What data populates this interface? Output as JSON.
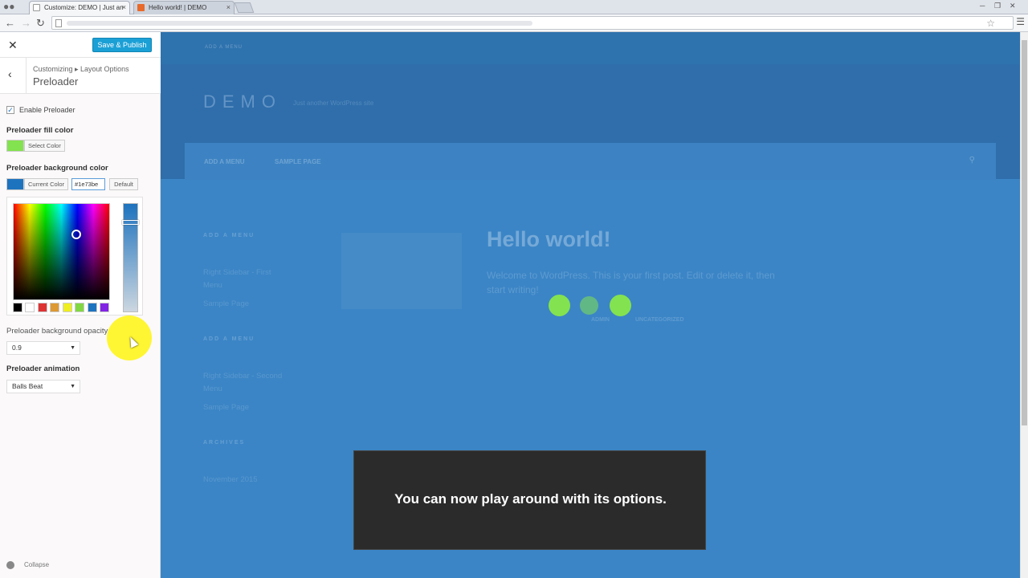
{
  "browser": {
    "tabs": [
      {
        "title": "Customize: DEMO | Just an",
        "active": true
      },
      {
        "title": "Hello world! | DEMO",
        "active": false
      }
    ],
    "close_glyph": "×"
  },
  "customizer": {
    "save_label": "Save & Publish",
    "breadcrumb": "Customizing ▸ Layout Options",
    "section_title": "Preloader",
    "enable_label": "Enable Preloader",
    "enable_checked": true,
    "fill_color_label": "Preloader fill color",
    "fill_color": "#83e24f",
    "select_color_label": "Select Color",
    "bg_color_label": "Preloader background color",
    "bg_color": "#1e73be",
    "current_color_label": "Current Color",
    "hex_value": "#1e73be",
    "default_label": "Default",
    "palette": [
      "#000000",
      "#ffffff",
      "#dd3333",
      "#dd9933",
      "#eeee22",
      "#81d742",
      "#1e73be",
      "#8224e3"
    ],
    "opacity_label": "Preloader background opacity",
    "opacity_value": "0.9",
    "animation_label": "Preloader animation",
    "animation_value": "Balls Beat",
    "collapse_label": "Collapse"
  },
  "preview": {
    "logo": "DEMO",
    "tagline": "Just another WordPress site",
    "nav_add_menu": "ADD A MENU",
    "nav_sample_page": "SAMPLE PAGE",
    "widget1_title": "ADD A MENU",
    "widget1_line1": "Right Sidebar - First",
    "widget1_line2": "Menu",
    "widget1_link": "Sample Page",
    "widget2_title": "ADD A MENU",
    "widget2_line1": "Right Sidebar - Second",
    "widget2_line2": "Menu",
    "widget2_link": "Sample Page",
    "archives_title": "ARCHIVES",
    "archives_item": "November 2015",
    "post_title": "Hello world!",
    "post_excerpt": "Welcome to WordPress. This is your first post. Edit or delete it, then start writing!",
    "meta_author": "ADMIN",
    "meta_category": "UNCATEGORIZED",
    "ball_color": "#83e24f"
  },
  "caption": {
    "text": "You can now play around with its options."
  }
}
